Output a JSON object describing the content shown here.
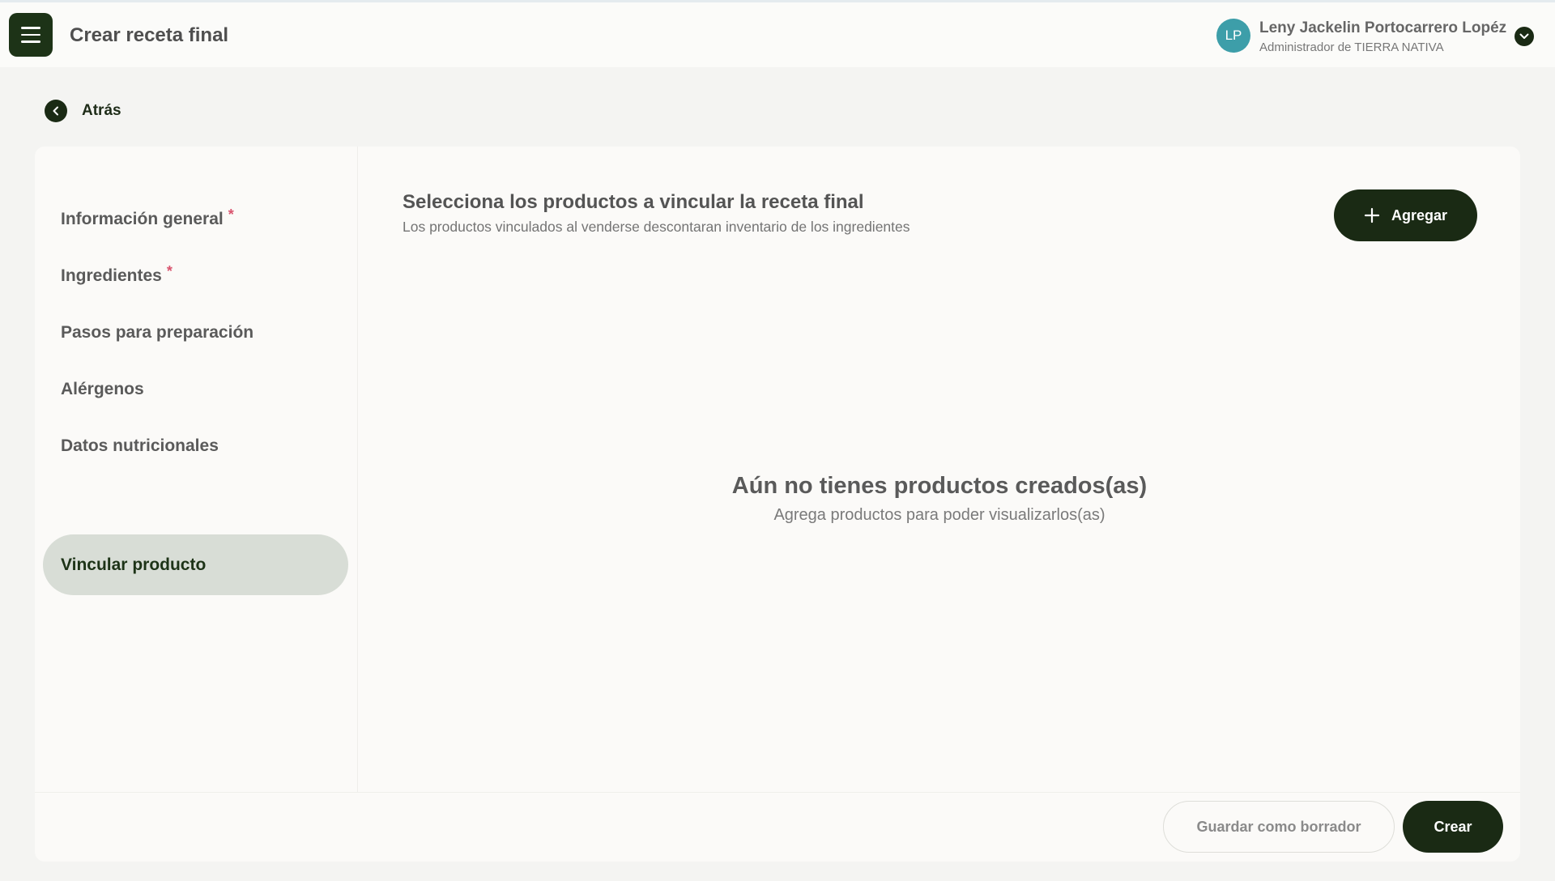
{
  "header": {
    "title": "Crear receta final",
    "user": {
      "initials": "LP",
      "name": "Leny Jackelin Portocarrero Lopéz",
      "role": "Administrador de TIERRA NATIVA"
    }
  },
  "back": {
    "label": "Atrás"
  },
  "sidebar": {
    "items": [
      {
        "label": "Información general",
        "required_mark": "*"
      },
      {
        "label": "Ingredientes",
        "required_mark": "*"
      },
      {
        "label": "Pasos para preparación"
      },
      {
        "label": "Alérgenos"
      },
      {
        "label": "Datos nutricionales"
      },
      {
        "label": "Vincular producto",
        "active": true
      }
    ]
  },
  "content": {
    "title": "Selecciona los productos a vincular la receta final",
    "subtitle": "Los productos vinculados al venderse descontaran inventario de los ingredientes",
    "add_button": "Agregar",
    "empty_title": "Aún no tienes productos creados(as)",
    "empty_subtitle": "Agrega productos para poder visualizarlos(as)"
  },
  "footer": {
    "draft_button": "Guardar como borrador",
    "create_button": "Crear"
  },
  "colors": {
    "primary": "#1a2a14",
    "avatar": "#3d9ea9",
    "required": "#d9546e",
    "active_nav_bg": "#d8ddd6"
  }
}
